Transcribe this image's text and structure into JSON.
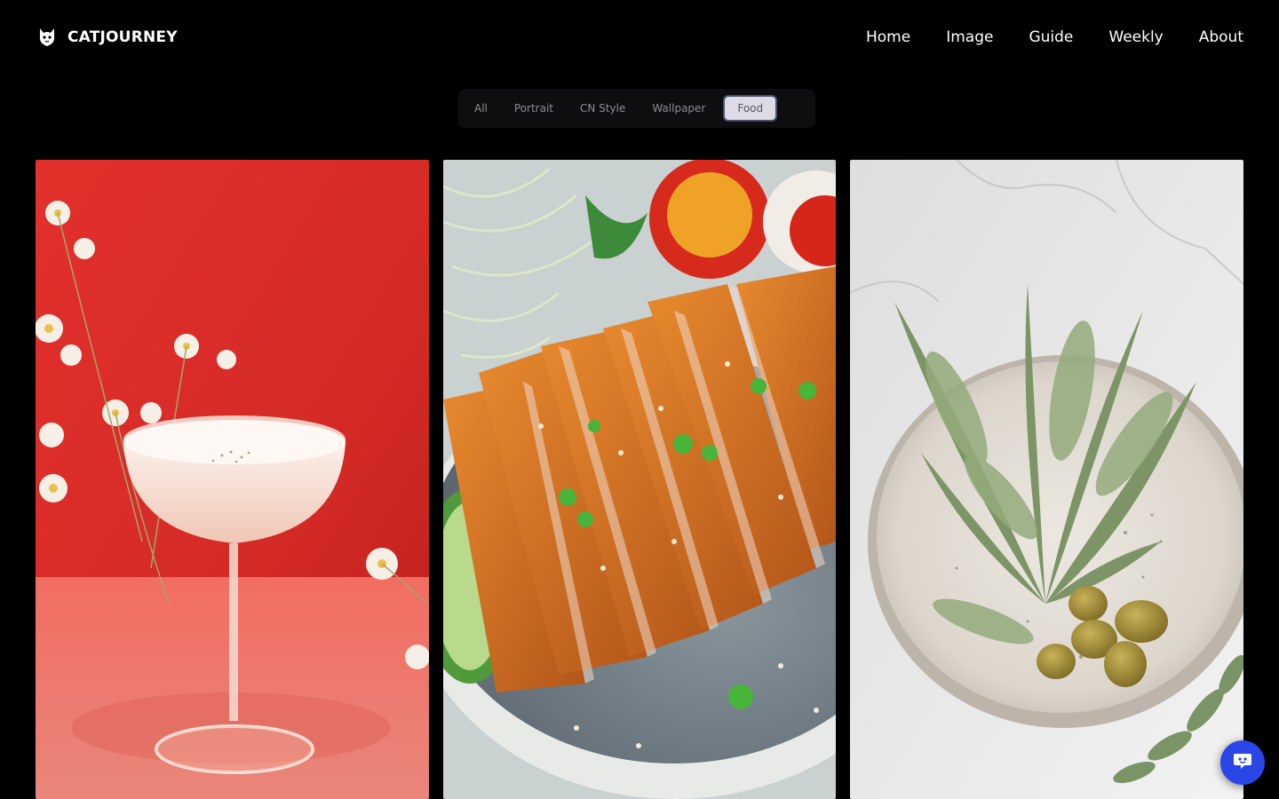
{
  "brand": {
    "name": "CATJOURNEY",
    "logo_icon": "cat-logo-icon"
  },
  "nav": {
    "items": [
      {
        "label": "Home"
      },
      {
        "label": "Image"
      },
      {
        "label": "Guide"
      },
      {
        "label": "Weekly"
      },
      {
        "label": "About"
      }
    ]
  },
  "filters": {
    "items": [
      {
        "label": "All"
      },
      {
        "label": "Portrait"
      },
      {
        "label": "CN Style"
      },
      {
        "label": "Wallpaper"
      },
      {
        "label": "Food"
      }
    ],
    "active": "Food"
  },
  "gallery": {
    "images": [
      {
        "subject": "cocktail-with-flowers"
      },
      {
        "subject": "fried-pork-cutlet"
      },
      {
        "subject": "sage-and-olives"
      }
    ]
  },
  "chat": {
    "icon": "chat-bot-icon",
    "color": "#2a46e6"
  }
}
